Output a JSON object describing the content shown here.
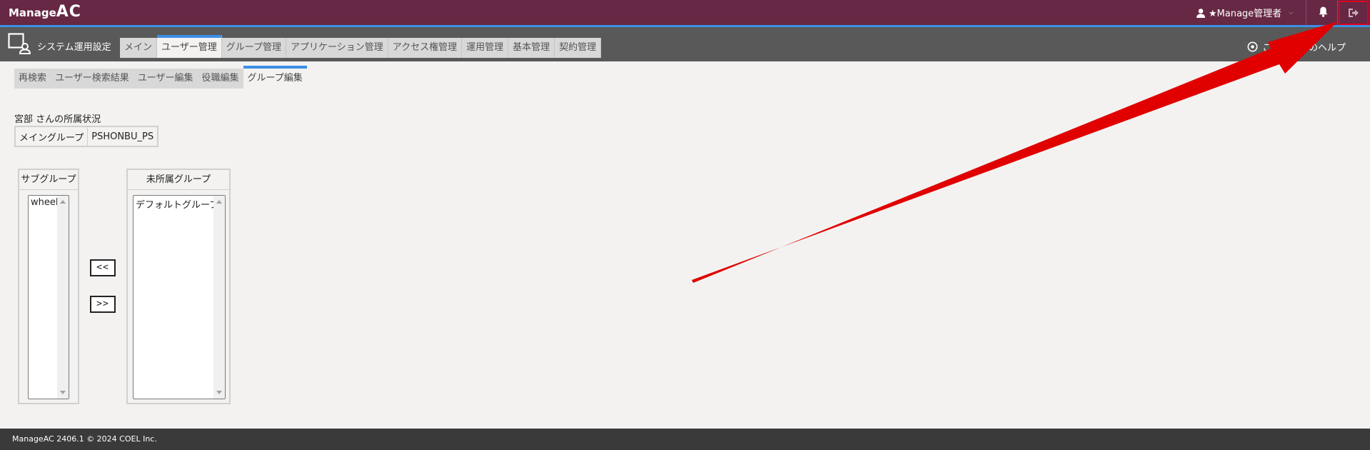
{
  "header": {
    "logo_part1": "Manage",
    "logo_part2": "AC",
    "user_label": "★Manage管理者",
    "bell_icon": "bell-icon",
    "logout_icon": "logout-icon"
  },
  "subbar": {
    "section_title": "システム運用設定",
    "help_label": "このページのヘルプ",
    "tabs": [
      "メイン",
      "ユーザー管理",
      "グループ管理",
      "アプリケーション管理",
      "アクセス権管理",
      "運用管理",
      "基本管理",
      "契約管理"
    ],
    "active_tab": "ユーザー管理"
  },
  "sub_tabs": {
    "items": [
      "再検索",
      "ユーザー検索結果",
      "ユーザー編集",
      "役職編集",
      "グループ編集"
    ],
    "active": "グループ編集"
  },
  "membership": {
    "title": "宮部 さんの所属状況",
    "main_group_label": "メイングループ",
    "main_group_value": "PSHONBU_PS"
  },
  "subgroups": {
    "title": "サブグループ",
    "options": [
      "wheel"
    ]
  },
  "unassigned": {
    "title": "未所属グループ",
    "options": [
      "デフォルトグループ"
    ]
  },
  "buttons": {
    "add": "<<",
    "remove": ">>"
  },
  "footer": {
    "text": "ManageAC 2406.1 © 2024 COEL Inc."
  },
  "colors": {
    "header_bg": "#662844",
    "accent": "#3b8fe6",
    "subbar_bg": "#595959",
    "footer_bg": "#3a3a3a",
    "annotation": "#e0001a"
  }
}
